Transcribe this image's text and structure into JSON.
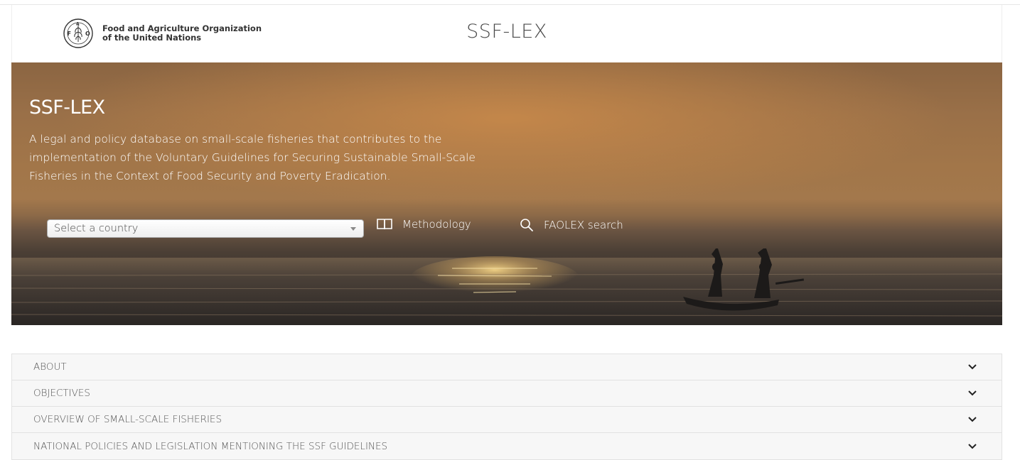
{
  "header": {
    "org_line1": "Food and Agriculture Organization",
    "org_line2": "of the United Nations",
    "site_title": "SSF-LEX"
  },
  "hero": {
    "title": "SSF-LEX",
    "description": "A legal and policy database on small-scale fisheries that contributes to the implementation of the Voluntary Guidelines for Securing Sustainable Small-Scale Fisheries in the Context of Food Security and Poverty Eradication.",
    "country_select": {
      "selected": "Select a country"
    },
    "methodology_label": "Methodology",
    "faolex_label": "FAOLEX search"
  },
  "accordion": {
    "items": [
      {
        "label": "ABOUT"
      },
      {
        "label": "OBJECTIVES"
      },
      {
        "label": "OVERVIEW OF SMALL-SCALE FISHERIES"
      },
      {
        "label": "NATIONAL POLICIES AND LEGISLATION MENTIONING THE SSF GUIDELINES"
      }
    ]
  },
  "icons": {
    "logo": "fao-logo-icon",
    "methodology": "book-icon",
    "faolex": "search-icon",
    "accordion": "chevron-down-icon"
  }
}
